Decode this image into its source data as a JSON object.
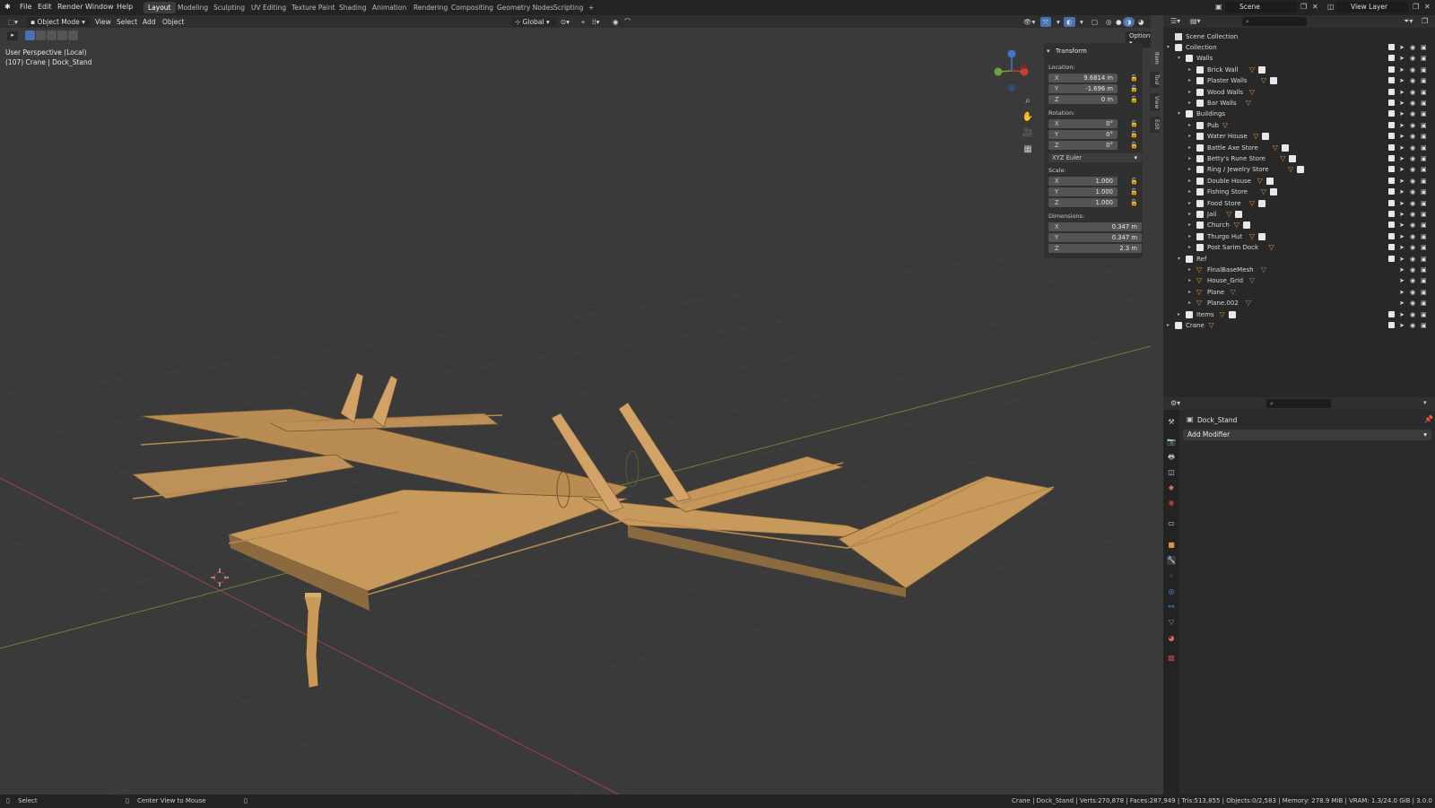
{
  "topbar": {
    "menus": [
      "File",
      "Edit",
      "Render",
      "Window",
      "Help"
    ],
    "workspaces": [
      "Layout",
      "Modeling",
      "Sculpting",
      "UV Editing",
      "Texture Paint",
      "Shading",
      "Animation",
      "Rendering",
      "Compositing",
      "Geometry Nodes",
      "Scripting"
    ],
    "add_tab": "+",
    "scene_name": "Scene",
    "view_layer": "View Layer"
  },
  "viewport_header": {
    "mode": "Object Mode",
    "menus": [
      "View",
      "Select",
      "Add",
      "Object"
    ],
    "orientation": "Global",
    "options": "Options"
  },
  "viewport": {
    "perspective_label": "User Perspective (Local)",
    "object_label": "(107) Crane | Dock_Stand",
    "gizmo_axes": {
      "x": "X",
      "y": "Y",
      "z": "Z"
    }
  },
  "npanel": {
    "title": "Transform",
    "location_label": "Location:",
    "location": {
      "x": "9.6814 m",
      "y": "-1.696 m",
      "z": "0 m"
    },
    "rotation_label": "Rotation:",
    "rotation": {
      "x": "0°",
      "y": "0°",
      "z": "0°"
    },
    "rotation_mode": "XYZ Euler",
    "scale_label": "Scale:",
    "scale": {
      "x": "1.000",
      "y": "1.000",
      "z": "1.000"
    },
    "dimensions_label": "Dimensions:",
    "dimensions": {
      "x": "0.347 m",
      "y": "0.347 m",
      "z": "2.3 m"
    },
    "tabs": [
      "Item",
      "Tool",
      "View",
      "Edit"
    ]
  },
  "outliner": {
    "root": "Scene Collection",
    "rows": [
      {
        "label": "Collection",
        "type": "collection",
        "icons": ""
      },
      {
        "label": "Walls",
        "type": "collection",
        "icons": ""
      },
      {
        "label": "Brick Wall",
        "type": "collection",
        "icons": "mesh-col"
      },
      {
        "label": "Plaster Walls",
        "type": "collection",
        "icons": "mesh-col"
      },
      {
        "label": "Wood Walls",
        "type": "collection",
        "icons": "mesh"
      },
      {
        "label": "Bar Walls",
        "type": "collection",
        "icons": "mesh"
      },
      {
        "label": "Buildings",
        "type": "collection",
        "icons": ""
      },
      {
        "label": "Pub",
        "type": "collection",
        "icons": "mesh"
      },
      {
        "label": "Water House",
        "type": "collection",
        "icons": "mesh-col"
      },
      {
        "label": "Battle Axe Store",
        "type": "collection",
        "icons": "mesh-col"
      },
      {
        "label": "Betty's Rune Store",
        "type": "collection",
        "icons": "mesh-col"
      },
      {
        "label": "Ring / Jewelry Store",
        "type": "collection",
        "icons": "mesh-col"
      },
      {
        "label": "Double House",
        "type": "collection",
        "icons": "mesh-col"
      },
      {
        "label": "Fishing Store",
        "type": "collection",
        "icons": "mesh-col"
      },
      {
        "label": "Food Store",
        "type": "collection",
        "icons": "mesh-col"
      },
      {
        "label": "Jail",
        "type": "collection",
        "icons": "mesh-col"
      },
      {
        "label": "Church",
        "type": "collection",
        "icons": "mesh-col"
      },
      {
        "label": "Thurgo Hut",
        "type": "collection",
        "icons": "mesh-col"
      },
      {
        "label": "Post Sarim Dock",
        "type": "collection",
        "icons": "mesh"
      },
      {
        "label": "Ref",
        "type": "collection",
        "icons": ""
      },
      {
        "label": "FinalBaseMesh",
        "type": "object",
        "icons": "green"
      },
      {
        "label": "House_Grid",
        "type": "object",
        "icons": "green"
      },
      {
        "label": "Plane",
        "type": "object",
        "icons": "green"
      },
      {
        "label": "Plane.002",
        "type": "object",
        "icons": "green"
      },
      {
        "label": "Items",
        "type": "collection",
        "icons": "mesh-col"
      },
      {
        "label": "Crane",
        "type": "collection",
        "icons": "mesh"
      }
    ]
  },
  "properties": {
    "object_name": "Dock_Stand",
    "add_modifier": "Add Modifier"
  },
  "statusbar": {
    "select": "Select",
    "center_view": "Center View to Mouse",
    "stats": "Crane | Dock_Stand | Verts:270,878 | Faces:287,949 | Tris:513,855 | Objects:0/2,583 | Memory: 278.9 MiB | VRAM: 1.3/24.0 GiB | 3.0.0"
  },
  "colors": {
    "accent": "#4772b3",
    "wood": "#c79a5c",
    "x_axis": "#c83b3b",
    "y_axis": "#6fa040",
    "z_axis": "#3f75c6",
    "mesh_icon": "#e0913b",
    "object_icon": "#5fb35a"
  }
}
